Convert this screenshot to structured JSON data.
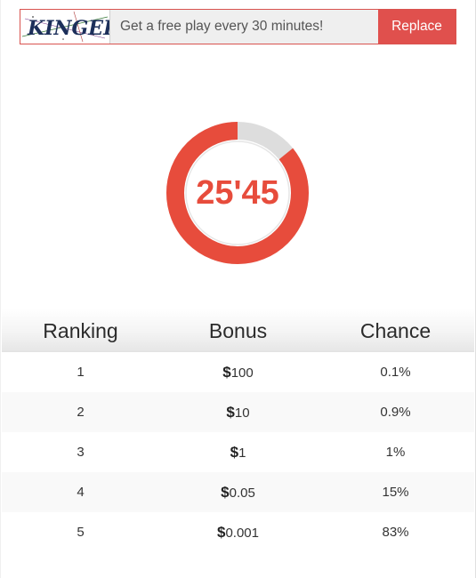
{
  "banner": {
    "captcha_text": "KINGED",
    "message": "Get a free play every 30 minutes!",
    "replace_label": "Replace"
  },
  "timer": {
    "display": "25'45",
    "progress_fraction": 0.858,
    "accent_color": "#e74c3c",
    "track_color": "#dddddd"
  },
  "table": {
    "headers": [
      "Ranking",
      "Bonus",
      "Chance"
    ],
    "rows": [
      {
        "rank": "1",
        "currency": "$",
        "amount": "100",
        "chance": "0.1%"
      },
      {
        "rank": "2",
        "currency": "$",
        "amount": "10",
        "chance": "0.9%"
      },
      {
        "rank": "3",
        "currency": "$",
        "amount": "1",
        "chance": "1%"
      },
      {
        "rank": "4",
        "currency": "$",
        "amount": "0.05",
        "chance": "15%"
      },
      {
        "rank": "5",
        "currency": "$",
        "amount": "0.001",
        "chance": "83%"
      }
    ]
  }
}
